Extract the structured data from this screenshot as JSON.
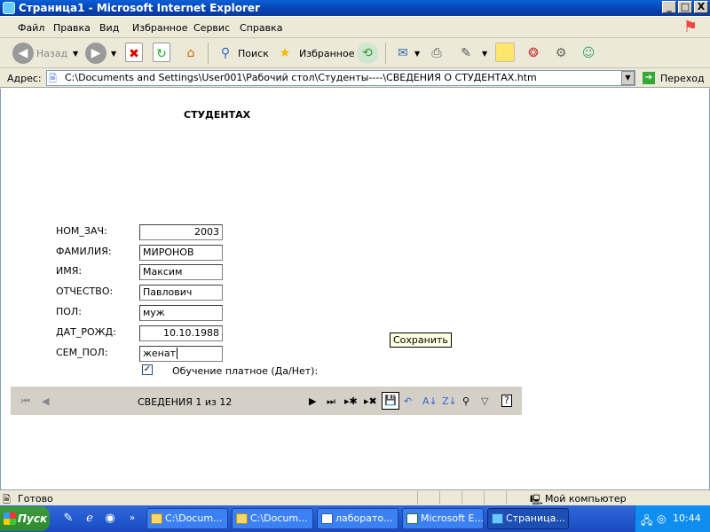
{
  "window": {
    "title": "Страница1 - Microsoft Internet Explorer",
    "minimize": "_",
    "maximize": "□",
    "close": "X"
  },
  "menu": [
    "Файл",
    "Правка",
    "Вид",
    "Избранное",
    "Сервис",
    "Справка"
  ],
  "toolbar": {
    "back": "Назад",
    "search": "Поиск",
    "favorites": "Избранное"
  },
  "address": {
    "label": "Адрес:",
    "url": "C:\\Documents and Settings\\User001\\Рабочий стол\\Студенты----\\СВЕДЕНИЯ О СТУДЕНТАХ.htm",
    "go": "Переход"
  },
  "page": {
    "heading": "СТУДЕНТАХ",
    "fields": [
      {
        "label": "НОМ_ЗАЧ:",
        "value": "2003"
      },
      {
        "label": "ФАМИЛИЯ:",
        "value": "МИРОНОВ"
      },
      {
        "label": "ИМЯ:",
        "value": "Максим"
      },
      {
        "label": "ОТЧЕСТВО:",
        "value": "Павлович"
      },
      {
        "label": "ПОЛ:",
        "value": "муж"
      },
      {
        "label": "ДАТ_РОЖД:",
        "value": "10.10.1988"
      },
      {
        "label": "СЕМ_ПОЛ:",
        "value": "женат"
      }
    ],
    "checkbox_label": "Обучение платное (Да/Нет):",
    "checkbox_checked": true,
    "navigation": "СВЕДЕНИЯ 1 из 12",
    "tooltip": "Сохранить"
  },
  "status": {
    "text": "Готово",
    "zone": "Мой компьютер"
  },
  "taskbar": {
    "start": "Пуск",
    "tasks": [
      "C:\\Docum...",
      "C:\\Docum...",
      "лаборато...",
      "Microsoft E...",
      "Страница..."
    ],
    "clock": "10:44"
  }
}
